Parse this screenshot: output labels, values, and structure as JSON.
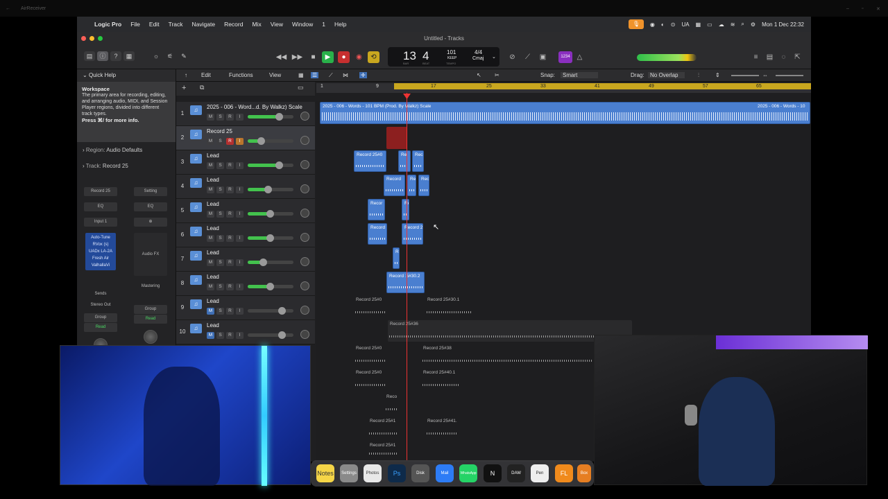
{
  "outer": {
    "title": "AirReceiver"
  },
  "menubar": {
    "app": "Logic Pro",
    "items": [
      "File",
      "Edit",
      "Track",
      "Navigate",
      "Record",
      "Mix",
      "View",
      "Window",
      "1",
      "Help"
    ],
    "lang": "UA",
    "datetime": "Mon 1 Dec  22:32"
  },
  "window": {
    "title": "Untitled - Tracks"
  },
  "lcd": {
    "bar": "13",
    "beat": "4",
    "bar_label": "BAR",
    "beat_label": "BEAT",
    "tempo": "101",
    "tempo_sub": "KEEP",
    "tempo_label": "TEMPO",
    "sig": "4/4",
    "key": "Cmaj"
  },
  "control_badge": "1234",
  "inspector": {
    "quick_help_title": "Quick Help",
    "help_head": "Workspace",
    "help_text": "The primary area for recording, editing, and arranging audio, MIDI, and Session Player regions, divided into different track types.",
    "help_more": "Press ⌘/ for more info.",
    "region_label": "Region:",
    "region_value": "Audio Defaults",
    "track_label": "Track:",
    "track_value": "Record 25",
    "strip1": {
      "name": "Record 25",
      "eq": "EQ",
      "input": "Input 1",
      "plugins": [
        "Auto-Tune",
        "RVox (s)",
        "UADx LA-2A",
        "Fresh Air",
        "ValhallaVi"
      ],
      "sends": "Sends",
      "out": "Stereo Out",
      "group": "Group",
      "auto": "Read"
    },
    "strip2": {
      "name": "Setting",
      "eq": "EQ",
      "fx": "Audio FX",
      "master": "Mastering",
      "group": "Group",
      "auto": "Read"
    }
  },
  "editor": {
    "edit": "Edit",
    "functions": "Functions",
    "view": "View",
    "snap_label": "Snap:",
    "snap": "Smart",
    "drag_label": "Drag:",
    "drag": "No Overlap"
  },
  "ruler": {
    "marks": [
      "1",
      "9",
      "17",
      "25",
      "33",
      "41",
      "49",
      "57",
      "65"
    ]
  },
  "tracks": [
    {
      "num": "1",
      "name": "2025 - 006 - Word...d. By Walkz) Scale",
      "fill": 0.7
    },
    {
      "num": "2",
      "name": "Record 25",
      "fill": 0.3
    },
    {
      "num": "3",
      "name": "Lead",
      "fill": 0.7
    },
    {
      "num": "4",
      "name": "Lead",
      "fill": 0.45
    },
    {
      "num": "5",
      "name": "Lead",
      "fill": 0.5
    },
    {
      "num": "6",
      "name": "Lead",
      "fill": 0.5
    },
    {
      "num": "7",
      "name": "Lead",
      "fill": 0.35
    },
    {
      "num": "8",
      "name": "Lead",
      "fill": 0.5
    },
    {
      "num": "9",
      "name": "Lead",
      "fill": 0.0
    },
    {
      "num": "10",
      "name": "Lead",
      "fill": 0.0
    }
  ],
  "regions": {
    "beat": "2025 - 006 - Words - 101 BPM (Prod. By Walkz) Scale",
    "beat_end": "2025 - 006 - Words - 10",
    "r3a": "Record 25#0",
    "r3b": "Re",
    "r3c": "Rec",
    "r4a": "Record",
    "r4b": "Re",
    "r4c": "Rec",
    "r5a": "Recor",
    "r5b": "Re",
    "r6a": "Record",
    "r6b": "Record 2",
    "r7a": "R",
    "r8a": "Record :5#30.2",
    "r9a": "Record 25#0",
    "r9b": "Record 25#30.1",
    "r10a": "Record 25#36",
    "r11a": "Record 25#0",
    "r11b": "Record 25#38",
    "r12a": "Record 25#0",
    "r12b": "Record 25#40.1",
    "r13a": "Reco",
    "r14a": "Record 25#1",
    "r14b": "Record 25#41.",
    "r15a": "Record 25#1"
  },
  "dock": [
    "Notes",
    "Settings",
    "Photos",
    "Ps",
    "Disk",
    "Mail",
    "WhatsApp",
    "N",
    "DAW",
    "Pen",
    "FL",
    "Box"
  ]
}
